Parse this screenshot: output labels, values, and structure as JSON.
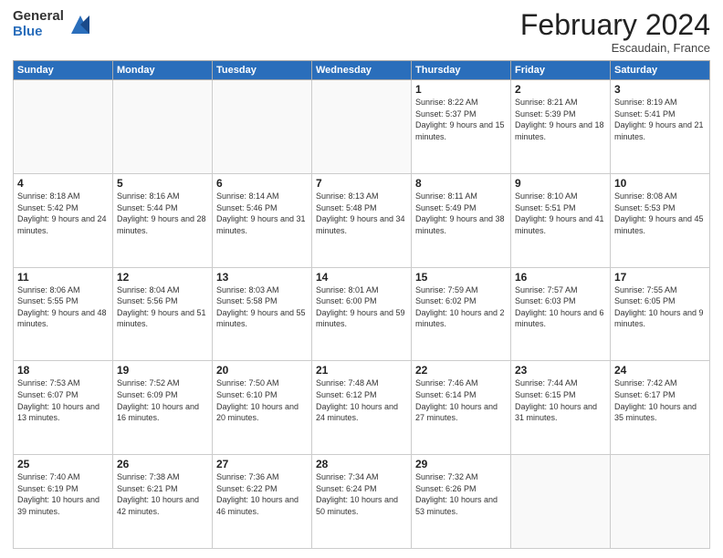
{
  "logo": {
    "general": "General",
    "blue": "Blue"
  },
  "header": {
    "month": "February 2024",
    "location": "Escaudain, France"
  },
  "days_of_week": [
    "Sunday",
    "Monday",
    "Tuesday",
    "Wednesday",
    "Thursday",
    "Friday",
    "Saturday"
  ],
  "weeks": [
    [
      {
        "day": "",
        "empty": true
      },
      {
        "day": "",
        "empty": true
      },
      {
        "day": "",
        "empty": true
      },
      {
        "day": "",
        "empty": true
      },
      {
        "day": "1",
        "sunrise": "8:22 AM",
        "sunset": "5:37 PM",
        "daylight": "9 hours and 15 minutes."
      },
      {
        "day": "2",
        "sunrise": "8:21 AM",
        "sunset": "5:39 PM",
        "daylight": "9 hours and 18 minutes."
      },
      {
        "day": "3",
        "sunrise": "8:19 AM",
        "sunset": "5:41 PM",
        "daylight": "9 hours and 21 minutes."
      }
    ],
    [
      {
        "day": "4",
        "sunrise": "8:18 AM",
        "sunset": "5:42 PM",
        "daylight": "9 hours and 24 minutes."
      },
      {
        "day": "5",
        "sunrise": "8:16 AM",
        "sunset": "5:44 PM",
        "daylight": "9 hours and 28 minutes."
      },
      {
        "day": "6",
        "sunrise": "8:14 AM",
        "sunset": "5:46 PM",
        "daylight": "9 hours and 31 minutes."
      },
      {
        "day": "7",
        "sunrise": "8:13 AM",
        "sunset": "5:48 PM",
        "daylight": "9 hours and 34 minutes."
      },
      {
        "day": "8",
        "sunrise": "8:11 AM",
        "sunset": "5:49 PM",
        "daylight": "9 hours and 38 minutes."
      },
      {
        "day": "9",
        "sunrise": "8:10 AM",
        "sunset": "5:51 PM",
        "daylight": "9 hours and 41 minutes."
      },
      {
        "day": "10",
        "sunrise": "8:08 AM",
        "sunset": "5:53 PM",
        "daylight": "9 hours and 45 minutes."
      }
    ],
    [
      {
        "day": "11",
        "sunrise": "8:06 AM",
        "sunset": "5:55 PM",
        "daylight": "9 hours and 48 minutes."
      },
      {
        "day": "12",
        "sunrise": "8:04 AM",
        "sunset": "5:56 PM",
        "daylight": "9 hours and 51 minutes."
      },
      {
        "day": "13",
        "sunrise": "8:03 AM",
        "sunset": "5:58 PM",
        "daylight": "9 hours and 55 minutes."
      },
      {
        "day": "14",
        "sunrise": "8:01 AM",
        "sunset": "6:00 PM",
        "daylight": "9 hours and 59 minutes."
      },
      {
        "day": "15",
        "sunrise": "7:59 AM",
        "sunset": "6:02 PM",
        "daylight": "10 hours and 2 minutes."
      },
      {
        "day": "16",
        "sunrise": "7:57 AM",
        "sunset": "6:03 PM",
        "daylight": "10 hours and 6 minutes."
      },
      {
        "day": "17",
        "sunrise": "7:55 AM",
        "sunset": "6:05 PM",
        "daylight": "10 hours and 9 minutes."
      }
    ],
    [
      {
        "day": "18",
        "sunrise": "7:53 AM",
        "sunset": "6:07 PM",
        "daylight": "10 hours and 13 minutes."
      },
      {
        "day": "19",
        "sunrise": "7:52 AM",
        "sunset": "6:09 PM",
        "daylight": "10 hours and 16 minutes."
      },
      {
        "day": "20",
        "sunrise": "7:50 AM",
        "sunset": "6:10 PM",
        "daylight": "10 hours and 20 minutes."
      },
      {
        "day": "21",
        "sunrise": "7:48 AM",
        "sunset": "6:12 PM",
        "daylight": "10 hours and 24 minutes."
      },
      {
        "day": "22",
        "sunrise": "7:46 AM",
        "sunset": "6:14 PM",
        "daylight": "10 hours and 27 minutes."
      },
      {
        "day": "23",
        "sunrise": "7:44 AM",
        "sunset": "6:15 PM",
        "daylight": "10 hours and 31 minutes."
      },
      {
        "day": "24",
        "sunrise": "7:42 AM",
        "sunset": "6:17 PM",
        "daylight": "10 hours and 35 minutes."
      }
    ],
    [
      {
        "day": "25",
        "sunrise": "7:40 AM",
        "sunset": "6:19 PM",
        "daylight": "10 hours and 39 minutes."
      },
      {
        "day": "26",
        "sunrise": "7:38 AM",
        "sunset": "6:21 PM",
        "daylight": "10 hours and 42 minutes."
      },
      {
        "day": "27",
        "sunrise": "7:36 AM",
        "sunset": "6:22 PM",
        "daylight": "10 hours and 46 minutes."
      },
      {
        "day": "28",
        "sunrise": "7:34 AM",
        "sunset": "6:24 PM",
        "daylight": "10 hours and 50 minutes."
      },
      {
        "day": "29",
        "sunrise": "7:32 AM",
        "sunset": "6:26 PM",
        "daylight": "10 hours and 53 minutes."
      },
      {
        "day": "",
        "empty": true
      },
      {
        "day": "",
        "empty": true
      }
    ]
  ]
}
